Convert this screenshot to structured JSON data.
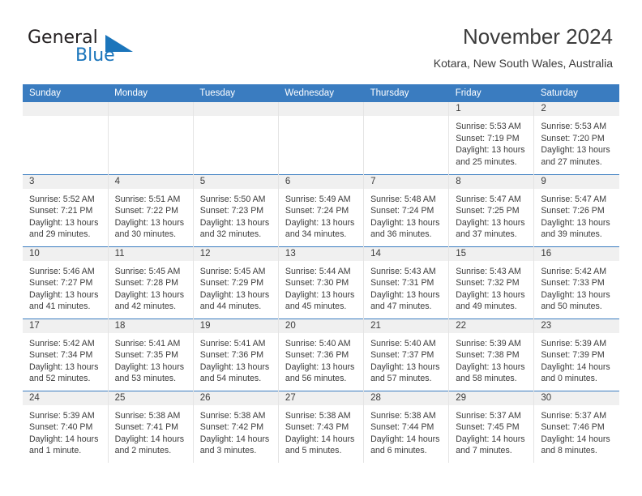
{
  "logo": {
    "word1": "General",
    "word2": "Blue",
    "triangle_color": "#1b75bb",
    "icon": "triangle-icon"
  },
  "header": {
    "title": "November 2024",
    "subtitle": "Kotara, New South Wales, Australia"
  },
  "theme": {
    "header_bg": "#3a7cc0",
    "daynum_bg": "#f0f0f0",
    "text": "#3b3b3b",
    "grid_line": "#e4e4e4",
    "accent": "#1b75bb"
  },
  "weekday_headers": [
    "Sunday",
    "Monday",
    "Tuesday",
    "Wednesday",
    "Thursday",
    "Friday",
    "Saturday"
  ],
  "weeks": [
    [
      {
        "day": "",
        "blank": true,
        "sunrise": "",
        "sunset": "",
        "daylight1": "",
        "daylight2": ""
      },
      {
        "day": "",
        "blank": true,
        "sunrise": "",
        "sunset": "",
        "daylight1": "",
        "daylight2": ""
      },
      {
        "day": "",
        "blank": true,
        "sunrise": "",
        "sunset": "",
        "daylight1": "",
        "daylight2": ""
      },
      {
        "day": "",
        "blank": true,
        "sunrise": "",
        "sunset": "",
        "daylight1": "",
        "daylight2": ""
      },
      {
        "day": "",
        "blank": true,
        "sunrise": "",
        "sunset": "",
        "daylight1": "",
        "daylight2": ""
      },
      {
        "day": "1",
        "blank": false,
        "sunrise": "Sunrise: 5:53 AM",
        "sunset": "Sunset: 7:19 PM",
        "daylight1": "Daylight: 13 hours",
        "daylight2": "and 25 minutes."
      },
      {
        "day": "2",
        "blank": false,
        "sunrise": "Sunrise: 5:53 AM",
        "sunset": "Sunset: 7:20 PM",
        "daylight1": "Daylight: 13 hours",
        "daylight2": "and 27 minutes."
      }
    ],
    [
      {
        "day": "3",
        "blank": false,
        "sunrise": "Sunrise: 5:52 AM",
        "sunset": "Sunset: 7:21 PM",
        "daylight1": "Daylight: 13 hours",
        "daylight2": "and 29 minutes."
      },
      {
        "day": "4",
        "blank": false,
        "sunrise": "Sunrise: 5:51 AM",
        "sunset": "Sunset: 7:22 PM",
        "daylight1": "Daylight: 13 hours",
        "daylight2": "and 30 minutes."
      },
      {
        "day": "5",
        "blank": false,
        "sunrise": "Sunrise: 5:50 AM",
        "sunset": "Sunset: 7:23 PM",
        "daylight1": "Daylight: 13 hours",
        "daylight2": "and 32 minutes."
      },
      {
        "day": "6",
        "blank": false,
        "sunrise": "Sunrise: 5:49 AM",
        "sunset": "Sunset: 7:24 PM",
        "daylight1": "Daylight: 13 hours",
        "daylight2": "and 34 minutes."
      },
      {
        "day": "7",
        "blank": false,
        "sunrise": "Sunrise: 5:48 AM",
        "sunset": "Sunset: 7:24 PM",
        "daylight1": "Daylight: 13 hours",
        "daylight2": "and 36 minutes."
      },
      {
        "day": "8",
        "blank": false,
        "sunrise": "Sunrise: 5:47 AM",
        "sunset": "Sunset: 7:25 PM",
        "daylight1": "Daylight: 13 hours",
        "daylight2": "and 37 minutes."
      },
      {
        "day": "9",
        "blank": false,
        "sunrise": "Sunrise: 5:47 AM",
        "sunset": "Sunset: 7:26 PM",
        "daylight1": "Daylight: 13 hours",
        "daylight2": "and 39 minutes."
      }
    ],
    [
      {
        "day": "10",
        "blank": false,
        "sunrise": "Sunrise: 5:46 AM",
        "sunset": "Sunset: 7:27 PM",
        "daylight1": "Daylight: 13 hours",
        "daylight2": "and 41 minutes."
      },
      {
        "day": "11",
        "blank": false,
        "sunrise": "Sunrise: 5:45 AM",
        "sunset": "Sunset: 7:28 PM",
        "daylight1": "Daylight: 13 hours",
        "daylight2": "and 42 minutes."
      },
      {
        "day": "12",
        "blank": false,
        "sunrise": "Sunrise: 5:45 AM",
        "sunset": "Sunset: 7:29 PM",
        "daylight1": "Daylight: 13 hours",
        "daylight2": "and 44 minutes."
      },
      {
        "day": "13",
        "blank": false,
        "sunrise": "Sunrise: 5:44 AM",
        "sunset": "Sunset: 7:30 PM",
        "daylight1": "Daylight: 13 hours",
        "daylight2": "and 45 minutes."
      },
      {
        "day": "14",
        "blank": false,
        "sunrise": "Sunrise: 5:43 AM",
        "sunset": "Sunset: 7:31 PM",
        "daylight1": "Daylight: 13 hours",
        "daylight2": "and 47 minutes."
      },
      {
        "day": "15",
        "blank": false,
        "sunrise": "Sunrise: 5:43 AM",
        "sunset": "Sunset: 7:32 PM",
        "daylight1": "Daylight: 13 hours",
        "daylight2": "and 49 minutes."
      },
      {
        "day": "16",
        "blank": false,
        "sunrise": "Sunrise: 5:42 AM",
        "sunset": "Sunset: 7:33 PM",
        "daylight1": "Daylight: 13 hours",
        "daylight2": "and 50 minutes."
      }
    ],
    [
      {
        "day": "17",
        "blank": false,
        "sunrise": "Sunrise: 5:42 AM",
        "sunset": "Sunset: 7:34 PM",
        "daylight1": "Daylight: 13 hours",
        "daylight2": "and 52 minutes."
      },
      {
        "day": "18",
        "blank": false,
        "sunrise": "Sunrise: 5:41 AM",
        "sunset": "Sunset: 7:35 PM",
        "daylight1": "Daylight: 13 hours",
        "daylight2": "and 53 minutes."
      },
      {
        "day": "19",
        "blank": false,
        "sunrise": "Sunrise: 5:41 AM",
        "sunset": "Sunset: 7:36 PM",
        "daylight1": "Daylight: 13 hours",
        "daylight2": "and 54 minutes."
      },
      {
        "day": "20",
        "blank": false,
        "sunrise": "Sunrise: 5:40 AM",
        "sunset": "Sunset: 7:36 PM",
        "daylight1": "Daylight: 13 hours",
        "daylight2": "and 56 minutes."
      },
      {
        "day": "21",
        "blank": false,
        "sunrise": "Sunrise: 5:40 AM",
        "sunset": "Sunset: 7:37 PM",
        "daylight1": "Daylight: 13 hours",
        "daylight2": "and 57 minutes."
      },
      {
        "day": "22",
        "blank": false,
        "sunrise": "Sunrise: 5:39 AM",
        "sunset": "Sunset: 7:38 PM",
        "daylight1": "Daylight: 13 hours",
        "daylight2": "and 58 minutes."
      },
      {
        "day": "23",
        "blank": false,
        "sunrise": "Sunrise: 5:39 AM",
        "sunset": "Sunset: 7:39 PM",
        "daylight1": "Daylight: 14 hours",
        "daylight2": "and 0 minutes."
      }
    ],
    [
      {
        "day": "24",
        "blank": false,
        "sunrise": "Sunrise: 5:39 AM",
        "sunset": "Sunset: 7:40 PM",
        "daylight1": "Daylight: 14 hours",
        "daylight2": "and 1 minute."
      },
      {
        "day": "25",
        "blank": false,
        "sunrise": "Sunrise: 5:38 AM",
        "sunset": "Sunset: 7:41 PM",
        "daylight1": "Daylight: 14 hours",
        "daylight2": "and 2 minutes."
      },
      {
        "day": "26",
        "blank": false,
        "sunrise": "Sunrise: 5:38 AM",
        "sunset": "Sunset: 7:42 PM",
        "daylight1": "Daylight: 14 hours",
        "daylight2": "and 3 minutes."
      },
      {
        "day": "27",
        "blank": false,
        "sunrise": "Sunrise: 5:38 AM",
        "sunset": "Sunset: 7:43 PM",
        "daylight1": "Daylight: 14 hours",
        "daylight2": "and 5 minutes."
      },
      {
        "day": "28",
        "blank": false,
        "sunrise": "Sunrise: 5:38 AM",
        "sunset": "Sunset: 7:44 PM",
        "daylight1": "Daylight: 14 hours",
        "daylight2": "and 6 minutes."
      },
      {
        "day": "29",
        "blank": false,
        "sunrise": "Sunrise: 5:37 AM",
        "sunset": "Sunset: 7:45 PM",
        "daylight1": "Daylight: 14 hours",
        "daylight2": "and 7 minutes."
      },
      {
        "day": "30",
        "blank": false,
        "sunrise": "Sunrise: 5:37 AM",
        "sunset": "Sunset: 7:46 PM",
        "daylight1": "Daylight: 14 hours",
        "daylight2": "and 8 minutes."
      }
    ]
  ]
}
